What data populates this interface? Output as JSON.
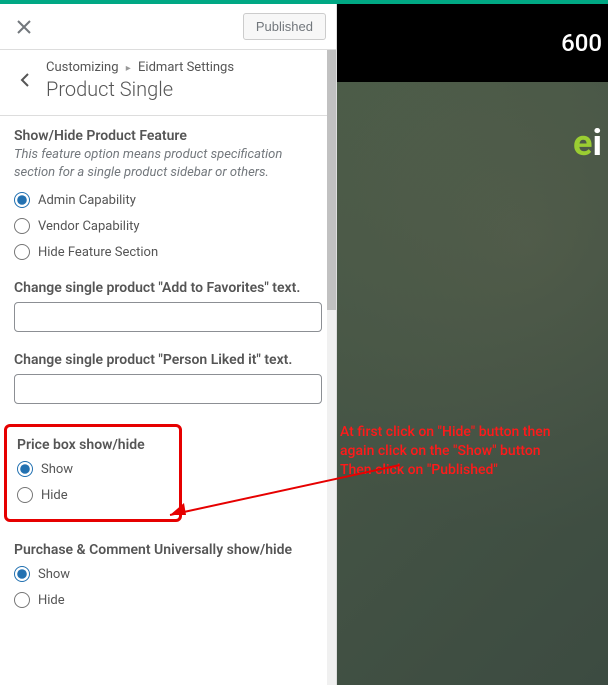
{
  "header": {
    "published_label": "Published"
  },
  "breadcrumb": {
    "root": "Customizing",
    "section": "Eidmart Settings",
    "title": "Product Single"
  },
  "feature": {
    "heading": "Show/Hide Product Feature",
    "desc": "This feature option means product specification section for a single product sidebar or others.",
    "options": {
      "admin": "Admin Capability",
      "vendor": "Vendor Capability",
      "hide": "Hide Feature Section"
    }
  },
  "favorites": {
    "label": "Change single product \"Add to Favorites\" text.",
    "value": ""
  },
  "liked": {
    "label": "Change single product \"Person Liked it\" text.",
    "value": ""
  },
  "pricebox": {
    "heading": "Price box show/hide",
    "show": "Show",
    "hide": "Hide"
  },
  "purchase": {
    "heading": "Purchase & Comment Universally show/hide",
    "show": "Show",
    "hide": "Hide"
  },
  "preview": {
    "topnum": "600"
  },
  "annotation": {
    "line1": "At first click on \"Hide\" button then",
    "line2": "again click on the \"Show\" button",
    "line3": "Then click on \"Published\""
  }
}
